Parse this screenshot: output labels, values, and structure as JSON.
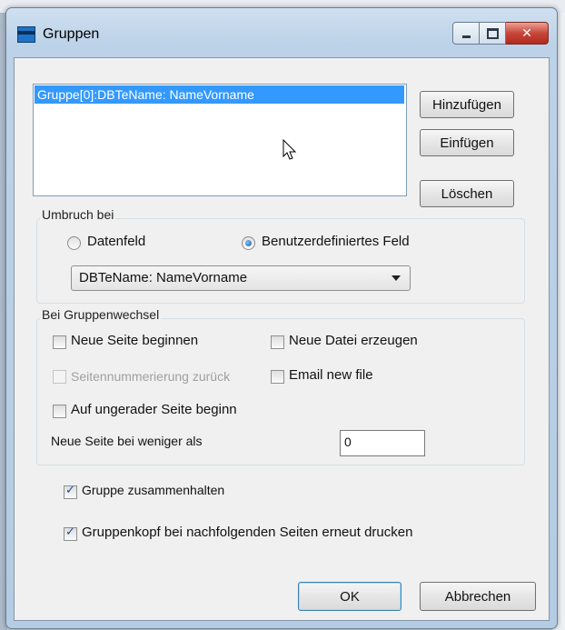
{
  "window": {
    "title": "Gruppen"
  },
  "list": {
    "items": [
      "Gruppe[0]:DBTeName: NameVorname"
    ]
  },
  "buttons": {
    "add": "Hinzufügen",
    "insert": "Einfügen",
    "delete": "Löschen",
    "ok": "OK",
    "cancel": "Abbrechen"
  },
  "break_group": {
    "legend": "Umbruch bei",
    "radio_datafield": "Datenfeld",
    "radio_custom": "Benutzerdefiniertes Feld",
    "selected_radio": "Benutzerdefiniertes Feld",
    "combo_value": "DBTeName: NameVorname"
  },
  "group_change": {
    "legend": "Bei Gruppenwechsel",
    "new_page": "Neue Seite beginnen",
    "new_file": "Neue Datei erzeugen",
    "reset_numbering": "Seitennummerierung zurück",
    "email_new_file": "Email new file",
    "odd_page": "Auf ungerader Seite beginn",
    "new_page_if_less_label": "Neue Seite bei weniger als",
    "new_page_if_less_value": "0"
  },
  "options": {
    "keep_together": "Gruppe zusammenhalten",
    "reprint_header": "Gruppenkopf bei nachfolgenden Seiten erneut drucken"
  },
  "colors": {
    "selection": "#3399ff",
    "close_button": "#c8453a"
  }
}
